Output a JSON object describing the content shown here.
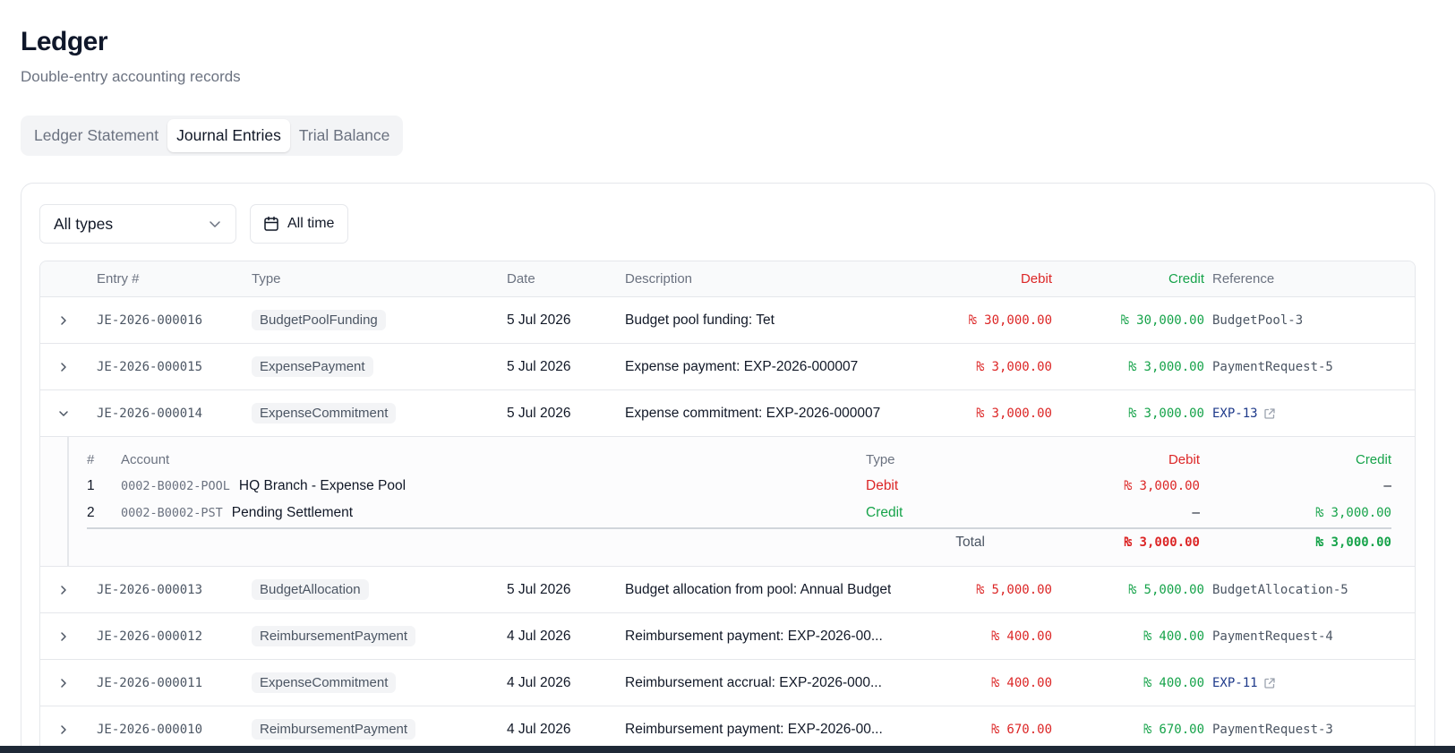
{
  "page": {
    "title": "Ledger",
    "subtitle": "Double-entry accounting records"
  },
  "tabs": [
    {
      "label": "Ledger Statement",
      "active": false
    },
    {
      "label": "Journal Entries",
      "active": true
    },
    {
      "label": "Trial Balance",
      "active": false
    }
  ],
  "filters": {
    "type_select": "All types",
    "date_button": "All time"
  },
  "table": {
    "headers": {
      "entry": "Entry #",
      "type": "Type",
      "date": "Date",
      "description": "Description",
      "debit": "Debit",
      "credit": "Credit",
      "reference": "Reference"
    },
    "rows": [
      {
        "entry": "JE-2026-000016",
        "type": "BudgetPoolFunding",
        "date": "5 Jul 2026",
        "description": "Budget pool funding: Tet",
        "debit": "₨ 30,000.00",
        "credit": "₨ 30,000.00",
        "reference": "BudgetPool-3"
      },
      {
        "entry": "JE-2026-000015",
        "type": "ExpensePayment",
        "date": "5 Jul 2026",
        "description": "Expense payment: EXP-2026-000007",
        "debit": "₨ 3,000.00",
        "credit": "₨ 3,000.00",
        "reference": "PaymentRequest-5"
      },
      {
        "entry": "JE-2026-000014",
        "type": "ExpenseCommitment",
        "date": "5 Jul 2026",
        "description": "Expense commitment: EXP-2026-000007",
        "debit": "₨ 3,000.00",
        "credit": "₨ 3,000.00",
        "reference": "EXP-13"
      },
      {
        "entry": "JE-2026-000013",
        "type": "BudgetAllocation",
        "date": "5 Jul 2026",
        "description": "Budget allocation from pool: Annual Budget",
        "debit": "₨ 5,000.00",
        "credit": "₨ 5,000.00",
        "reference": "BudgetAllocation-5"
      },
      {
        "entry": "JE-2026-000012",
        "type": "ReimbursementPayment",
        "date": "4 Jul 2026",
        "description": "Reimbursement payment: EXP-2026-00...",
        "debit": "₨ 400.00",
        "credit": "₨ 400.00",
        "reference": "PaymentRequest-4"
      },
      {
        "entry": "JE-2026-000011",
        "type": "ExpenseCommitment",
        "date": "4 Jul 2026",
        "description": "Reimbursement accrual: EXP-2026-000...",
        "debit": "₨ 400.00",
        "credit": "₨ 400.00",
        "reference": "EXP-11"
      },
      {
        "entry": "JE-2026-000010",
        "type": "ReimbursementPayment",
        "date": "4 Jul 2026",
        "description": "Reimbursement payment: EXP-2026-00...",
        "debit": "₨ 670.00",
        "credit": "₨ 670.00",
        "reference": "PaymentRequest-3"
      }
    ],
    "detail": {
      "headers": {
        "num": "#",
        "account": "Account",
        "type": "Type",
        "debit": "Debit",
        "credit": "Credit"
      },
      "lines": [
        {
          "num": "1",
          "code": "0002-B0002-POOL",
          "name": "HQ Branch - Expense Pool",
          "type": "Debit",
          "debit": "₨ 3,000.00",
          "credit": "–"
        },
        {
          "num": "2",
          "code": "0002-B0002-PST",
          "name": "Pending Settlement",
          "type": "Credit",
          "debit": "–",
          "credit": "₨ 3,000.00"
        }
      ],
      "total_label": "Total",
      "total_debit": "₨ 3,000.00",
      "total_credit": "₨ 3,000.00"
    }
  },
  "colors": {
    "debit": "#dc2626",
    "credit": "#16a34a",
    "link": "#1e3a8a"
  },
  "icons": {
    "expand": "chevron-right-icon",
    "collapse": "chevron-down-icon",
    "calendar": "calendar-icon",
    "external": "external-link-icon"
  }
}
